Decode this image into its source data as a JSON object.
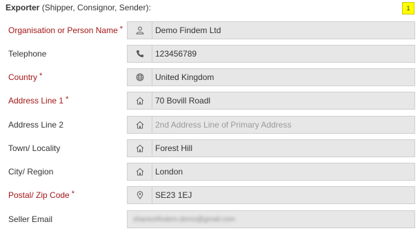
{
  "header": {
    "title_bold": "Exporter",
    "title_rest": " (Shipper, Consignor, Sender):",
    "badge": "1"
  },
  "fields": [
    {
      "label": "Organisation or Person Name",
      "required": true,
      "icon": "user-icon",
      "value": "Demo Findem Ltd"
    },
    {
      "label": "Telephone",
      "required": false,
      "icon": "phone-icon",
      "value": "123456789"
    },
    {
      "label": "Country",
      "required": true,
      "icon": "globe-icon",
      "value": "United Kingdom"
    },
    {
      "label": "Address Line 1",
      "required": true,
      "icon": "home-icon",
      "value": "70 Bovill Roadl"
    },
    {
      "label": "Address Line 2",
      "required": false,
      "icon": "home-icon",
      "placeholder": "2nd Address Line of Primary Address"
    },
    {
      "label": "Town/ Locality",
      "required": false,
      "icon": "home-icon",
      "value": "Forest Hill"
    },
    {
      "label": "City/ Region",
      "required": false,
      "icon": "home-icon",
      "value": "London"
    },
    {
      "label": "Postal/ Zip Code",
      "required": true,
      "icon": "map-marker-icon",
      "value": "SE23 1EJ"
    },
    {
      "label": "Seller Email",
      "required": false,
      "icon": "",
      "value": "shanicefindem.demo@gmail.com"
    }
  ],
  "colors": {
    "required_label": "#a31515",
    "field_bg": "#e7e7e7",
    "badge_bg": "#ffff00"
  }
}
